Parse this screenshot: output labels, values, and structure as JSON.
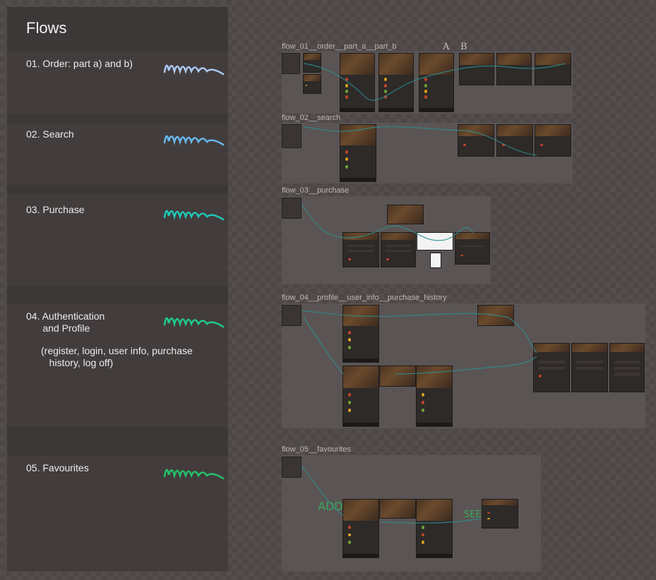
{
  "sidebar": {
    "title": "Flows",
    "flows": [
      {
        "label": "01. Order: part a) and b)",
        "color": "#a9c8f0"
      },
      {
        "label": "02. Search",
        "color": "#67b7ec"
      },
      {
        "label": "03. Purchase",
        "color": "#1fc6b8"
      },
      {
        "label": "04. Authentication\n      and Profile",
        "sub": "(register, login, user info, purchase\n   history, log off)",
        "color": "#1fc98a"
      },
      {
        "label": "05. Favourites",
        "color": "#25c06b"
      }
    ]
  },
  "canvas": {
    "frames": [
      {
        "title": "flow_01__order__part_a__part_b",
        "annotations": [
          "A",
          "B"
        ]
      },
      {
        "title": "flow_02__search"
      },
      {
        "title": "flow_03__purchase"
      },
      {
        "title": "flow_04__profile__user_info__purchase_history"
      },
      {
        "title": "flow_05__favourites",
        "annotations": [
          "ADD",
          "SEE"
        ]
      }
    ],
    "wire_color": "#2d8f8f"
  }
}
